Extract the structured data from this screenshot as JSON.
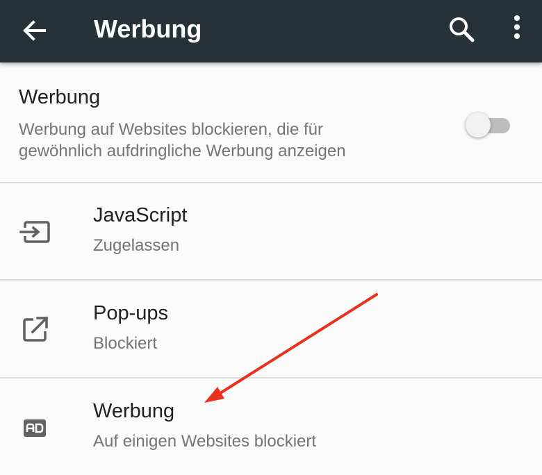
{
  "appbar": {
    "title": "Werbung",
    "back_icon": "arrow-back-icon",
    "search_icon": "search-icon",
    "more_icon": "more-vert-icon",
    "background": "#263238"
  },
  "ads_toggle": {
    "title": "Werbung",
    "description": "Werbung auf Websites blockieren, die für gewöhnlich aufdringliche Werbung anzeigen",
    "enabled": false
  },
  "items": [
    {
      "title": "JavaScript",
      "subtitle": "Zugelassen",
      "icon": "javascript-icon"
    },
    {
      "title": "Pop-ups",
      "subtitle": "Blockiert",
      "icon": "open-in-new-icon"
    },
    {
      "title": "Werbung",
      "subtitle": "Auf einigen Websites blockiert",
      "icon": "ad-icon"
    }
  ],
  "annotation": {
    "type": "arrow",
    "color": "#e8321e"
  }
}
